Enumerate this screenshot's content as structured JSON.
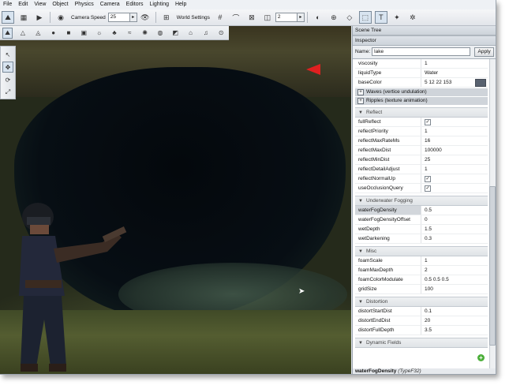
{
  "menu": [
    "File",
    "Edit",
    "View",
    "Object",
    "Physics",
    "Camera",
    "Editors",
    "Lighting",
    "Help"
  ],
  "toolbar": {
    "camera_speed_label": "Camera Speed",
    "camera_speed_value": "25",
    "world_settings_label": "World Settings",
    "snap_value": "2"
  },
  "panel": {
    "scene_tree_title": "Scene Tree",
    "inspector_title": "Inspector",
    "name_label": "Name:",
    "name_value": "lake",
    "apply_label": "Apply",
    "top_rows": [
      {
        "k": "viscosity",
        "v": "1"
      },
      {
        "k": "liquidType",
        "v": "Water"
      },
      {
        "k": "baseColor",
        "v": "5 12 22 153"
      }
    ],
    "sub_rows": [
      "Waves (vertice undulation)",
      "Ripples (texture animation)"
    ],
    "groups": [
      {
        "title": "Reflect",
        "rows": [
          {
            "k": "fullReflect",
            "v": "",
            "check": true
          },
          {
            "k": "reflectPriority",
            "v": "1"
          },
          {
            "k": "reflectMaxRateMs",
            "v": "16"
          },
          {
            "k": "reflectMaxDist",
            "v": "100000"
          },
          {
            "k": "reflectMinDist",
            "v": "25"
          },
          {
            "k": "reflectDetailAdjust",
            "v": "1"
          },
          {
            "k": "reflectNormalUp",
            "v": "",
            "check": true
          },
          {
            "k": "useOcclusionQuery",
            "v": "",
            "check": true
          }
        ]
      },
      {
        "title": "Underwater Fogging",
        "rows": [
          {
            "k": "waterFogDensity",
            "v": "0.5",
            "hl": true
          },
          {
            "k": "waterFogDensityOffset",
            "v": "0"
          },
          {
            "k": "wetDepth",
            "v": "1.5"
          },
          {
            "k": "wetDarkening",
            "v": "0.3"
          }
        ]
      },
      {
        "title": "Misc",
        "rows": [
          {
            "k": "foamScale",
            "v": "1"
          },
          {
            "k": "foamMaxDepth",
            "v": "2"
          },
          {
            "k": "foamColorModulate",
            "v": "0.5 0.5 0.5"
          },
          {
            "k": "gridSize",
            "v": "100"
          }
        ]
      },
      {
        "title": "Distortion",
        "rows": [
          {
            "k": "distortStartDist",
            "v": "0.1"
          },
          {
            "k": "distortEndDist",
            "v": "20"
          },
          {
            "k": "distortFullDepth",
            "v": "3.5"
          }
        ]
      }
    ],
    "dynamic_fields_title": "Dynamic Fields",
    "footer_field": "waterFogDensity",
    "footer_type": "(TypeF32)"
  },
  "colors": {
    "arrow": "#e02020",
    "add": "#4caf3a"
  }
}
